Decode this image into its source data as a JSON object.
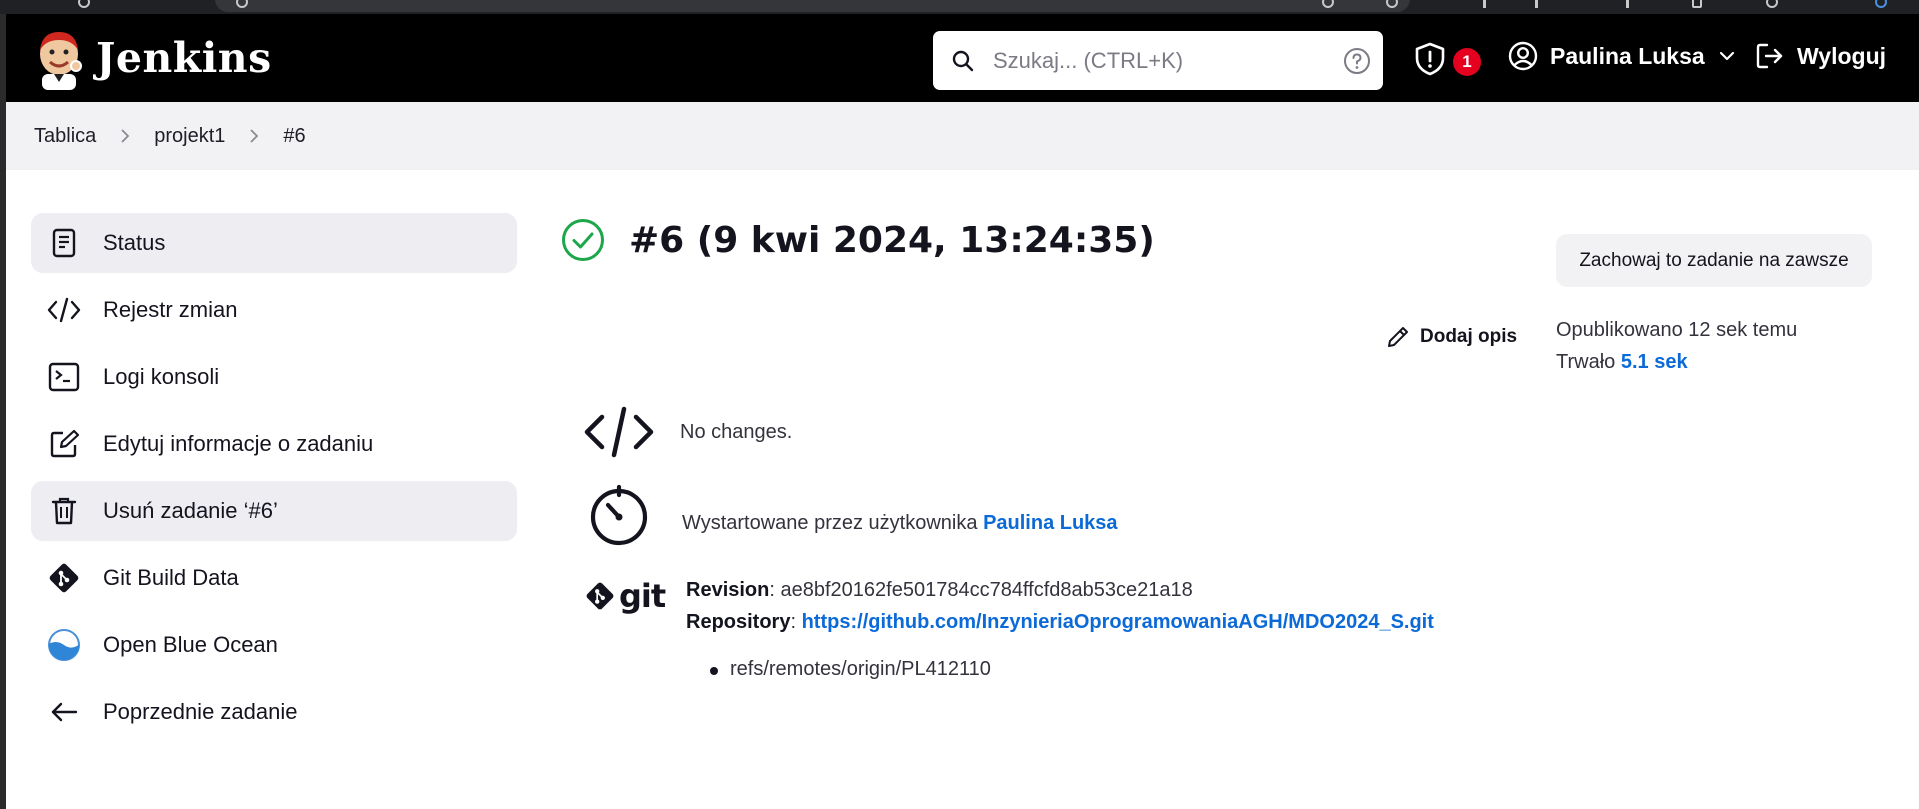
{
  "header": {
    "brand": "Jenkins",
    "search_placeholder": "Szukaj... (CTRL+K)",
    "notification_count": "1",
    "user_name": "Paulina Luksa",
    "logout_label": "Wyloguj"
  },
  "breadcrumb": [
    "Tablica",
    "projekt1",
    "#6"
  ],
  "sidebar": {
    "items": [
      {
        "label": "Status",
        "icon": "document-icon"
      },
      {
        "label": "Rejestr zmian",
        "icon": "code-icon"
      },
      {
        "label": "Logi konsoli",
        "icon": "terminal-icon"
      },
      {
        "label": "Edytuj informacje o zadaniu",
        "icon": "edit-icon"
      },
      {
        "label": "Usuń zadanie ‘#6’",
        "icon": "trash-icon"
      },
      {
        "label": "Git Build Data",
        "icon": "git-icon"
      },
      {
        "label": "Open Blue Ocean",
        "icon": "blue-ocean-icon"
      },
      {
        "label": "Poprzednie zadanie",
        "icon": "arrow-left-icon"
      }
    ]
  },
  "build": {
    "title": "#6 (9 kwi 2024, 13:24:35)",
    "status": "success",
    "keep_forever_label": "Zachowaj to zadanie na zawsze",
    "add_description_label": "Dodaj opis",
    "published": "Opublikowano 12 sek temu",
    "duration_prefix": "Trwało",
    "duration": "5.1 sek",
    "changes": "No changes.",
    "started_by_prefix": "Wystartowane przez użytkownika",
    "started_by_user": "Paulina Luksa",
    "git_logo_text": "git",
    "revision_label": "Revision",
    "revision": "ae8bf20162fe501784cc784ffcfd8ab53ce21a18",
    "repository_label": "Repository",
    "repository": "https://github.com/InzynieriaOprogramowaniaAGH/MDO2024_S.git",
    "branches": [
      "refs/remotes/origin/PL412110"
    ]
  },
  "colors": {
    "header_bg": "#000000",
    "link": "#0b6ad8",
    "success": "#1ea64b",
    "badge": "#e6001f",
    "breadcrumb_bg": "#f2f2f4"
  }
}
